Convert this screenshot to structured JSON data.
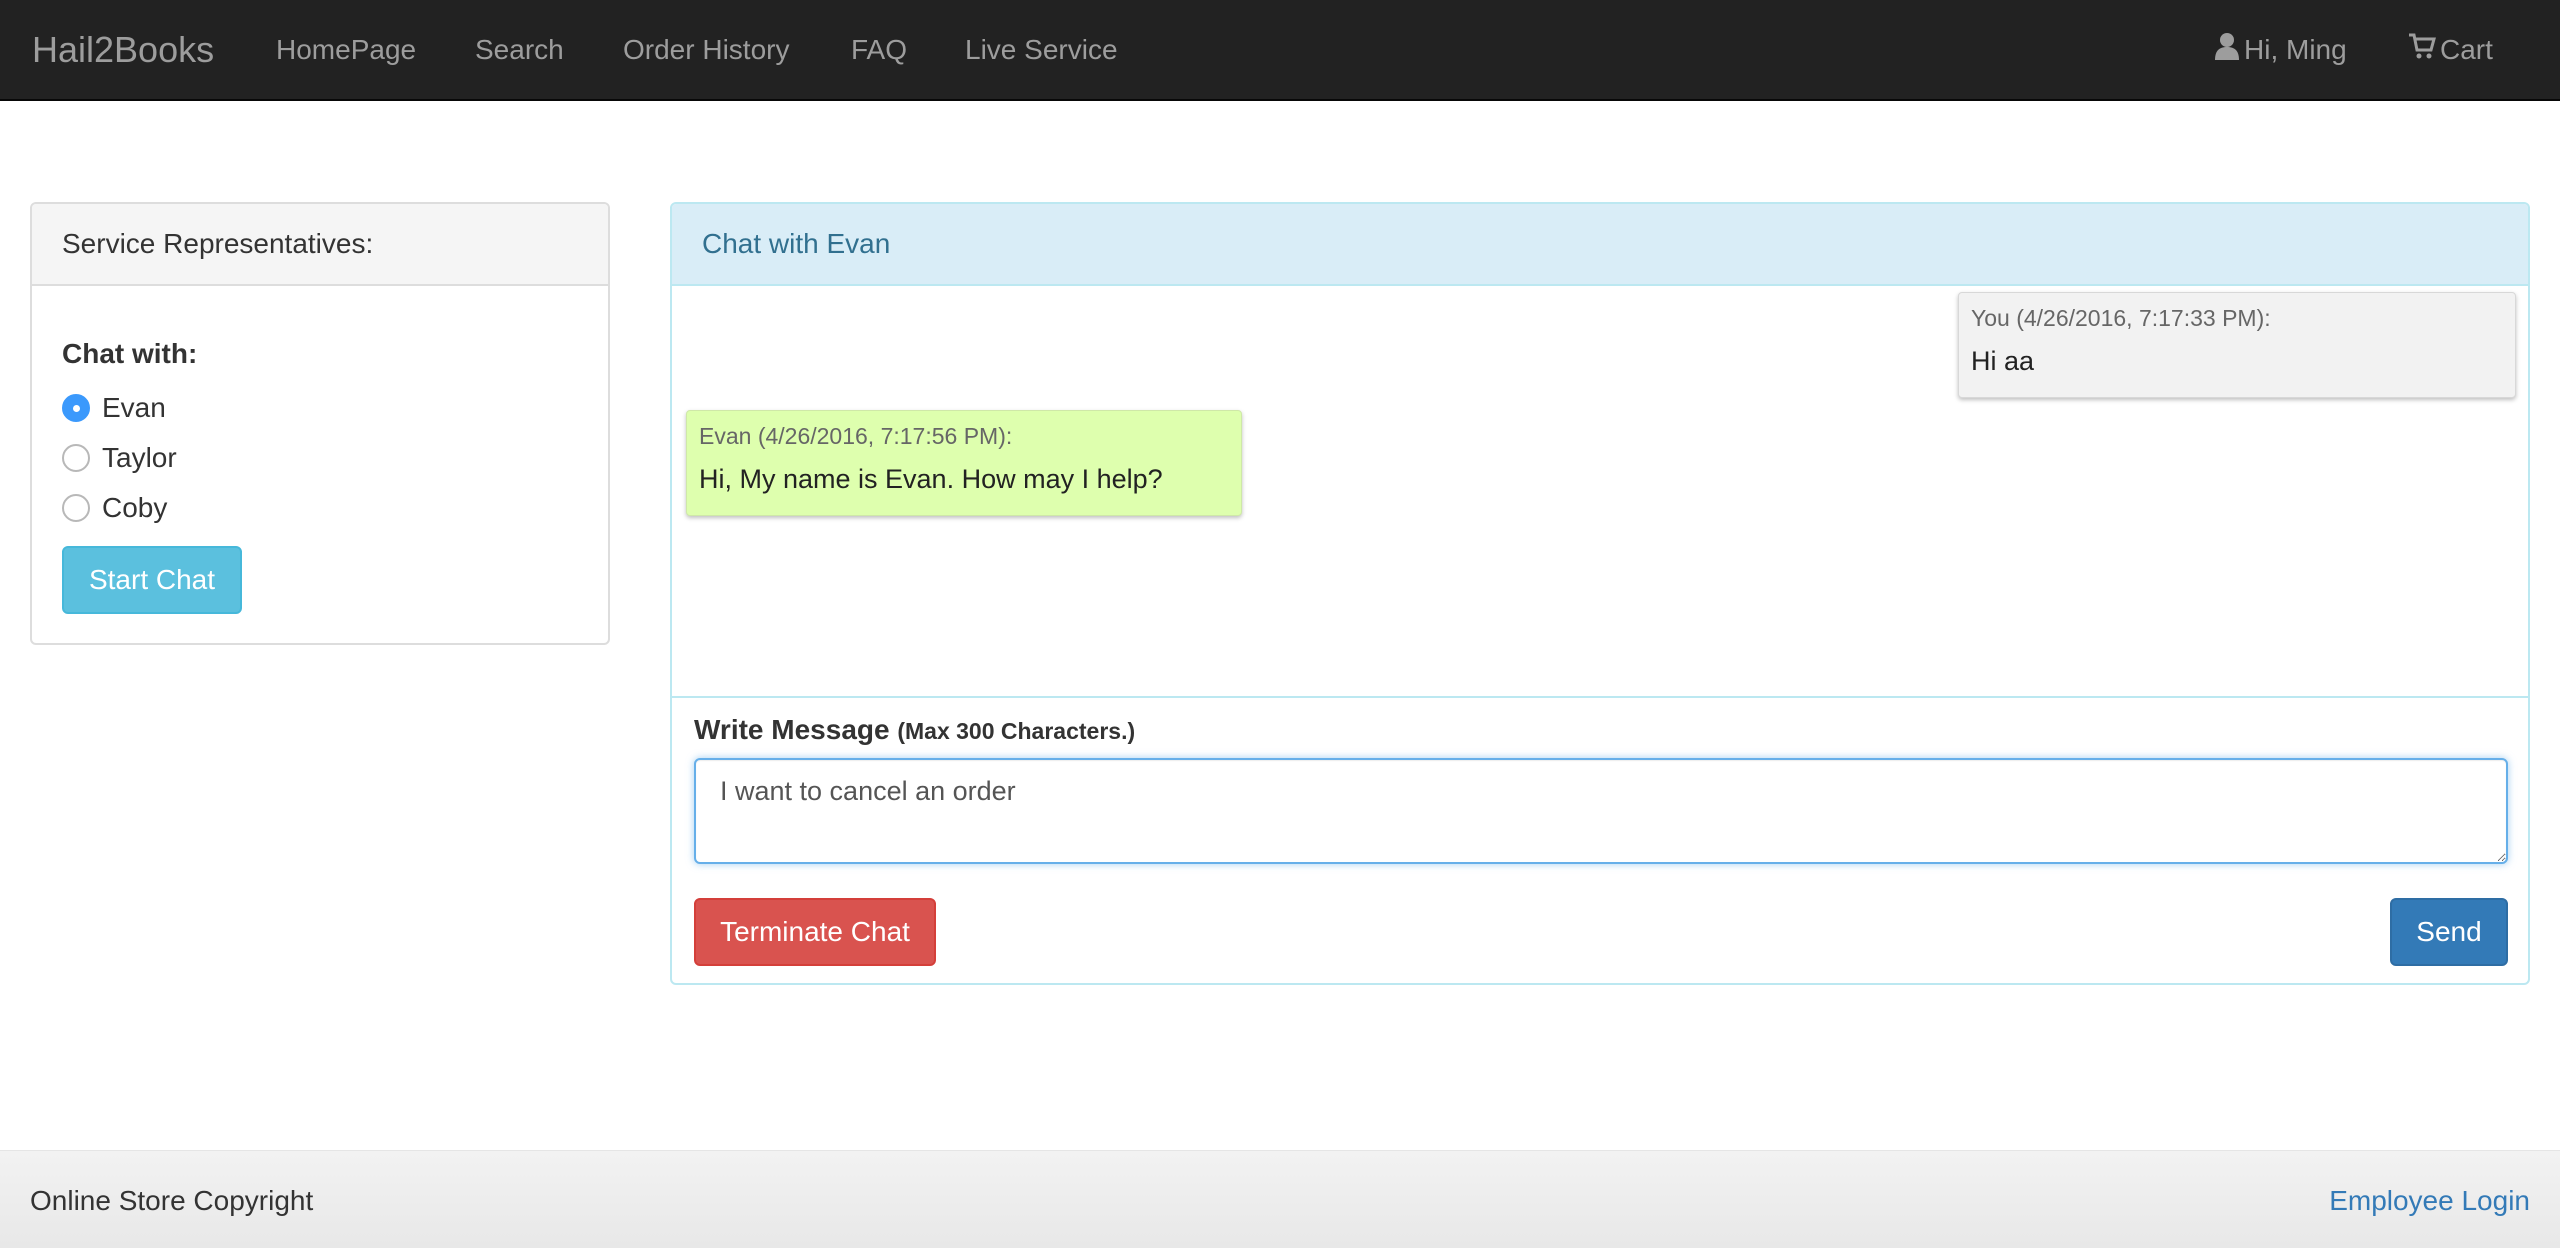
{
  "navbar": {
    "brand": "Hail2Books",
    "links": [
      "HomePage",
      "Search",
      "Order History",
      "FAQ",
      "Live Service"
    ],
    "user_label": "Hi, Ming",
    "cart_label": "Cart",
    "user_icon": "user-icon",
    "cart_icon": "cart-icon"
  },
  "reps_panel": {
    "heading": "Service Representatives:",
    "chat_with_label": "Chat with:",
    "options": [
      "Evan",
      "Taylor",
      "Coby"
    ],
    "selected": "Evan",
    "start_button": "Start Chat"
  },
  "chat_panel": {
    "heading": "Chat with Evan",
    "messages": [
      {
        "sender": "You",
        "meta": "You (4/26/2016, 7:17:33 PM):",
        "text": "Hi aa"
      },
      {
        "sender": "Evan",
        "meta": "Evan (4/26/2016, 7:17:56 PM):",
        "text": "Hi, My name is Evan. How may I help?"
      }
    ],
    "write_label": "Write Message",
    "write_hint": "(Max 300 Characters.)",
    "input_value": "I want to cancel an order",
    "terminate_button": "Terminate Chat",
    "send_button": "Send"
  },
  "footer": {
    "copyright": "Online Store Copyright",
    "employee_login": "Employee Login"
  },
  "colors": {
    "navbar_bg": "#222222",
    "info_heading_bg": "#d9edf7",
    "you_bubble": "#f2f2f2",
    "rep_bubble": "#deffae",
    "start_button": "#5bc0de",
    "terminate_button": "#d9534f",
    "send_button": "#337ab7"
  }
}
